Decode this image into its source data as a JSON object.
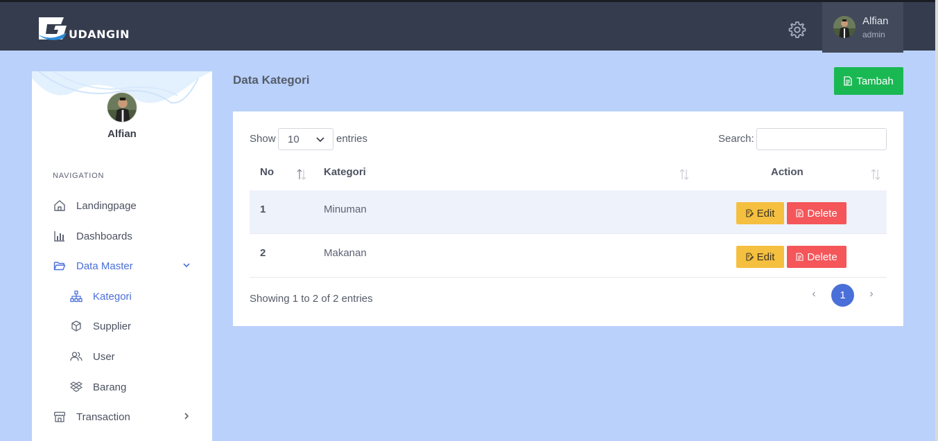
{
  "header": {
    "logo_text": "UDANGIN",
    "user_name": "Alfian",
    "user_role": "admin"
  },
  "sidebar": {
    "profile_name": "Alfian",
    "nav_title": "NAVIGATION",
    "items": [
      {
        "label": "Landingpage",
        "icon": "home-icon"
      },
      {
        "label": "Dashboards",
        "icon": "bar-chart-icon"
      },
      {
        "label": "Data Master",
        "icon": "folder-open-icon"
      },
      {
        "label": "Kategori",
        "icon": "sitemap-icon"
      },
      {
        "label": "Supplier",
        "icon": "box-icon"
      },
      {
        "label": "User",
        "icon": "users-icon"
      },
      {
        "label": "Barang",
        "icon": "dropbox-icon"
      },
      {
        "label": "Transaction",
        "icon": "store-icon"
      }
    ]
  },
  "main": {
    "title": "Data Kategori",
    "add_button": "Tambah",
    "table": {
      "show_label": "Show",
      "entries_value": "10",
      "entries_label": "entries",
      "search_label": "Search:",
      "search_value": "",
      "columns": [
        "No",
        "Kategori",
        "Action"
      ],
      "rows": [
        {
          "no": "1",
          "kategori": "Minuman"
        },
        {
          "no": "2",
          "kategori": "Makanan"
        }
      ],
      "edit_label": "Edit",
      "delete_label": "Delete",
      "info": "Showing 1 to 2 of 2 entries",
      "pagination": {
        "prev": "‹",
        "current": "1",
        "next": "›"
      }
    }
  },
  "colors": {
    "topbar": "#353c4e",
    "background": "#b9d1fb",
    "accent": "#4a6fd8",
    "add": "#1ab853",
    "edit": "#f5bf3f",
    "delete": "#f4565a"
  }
}
